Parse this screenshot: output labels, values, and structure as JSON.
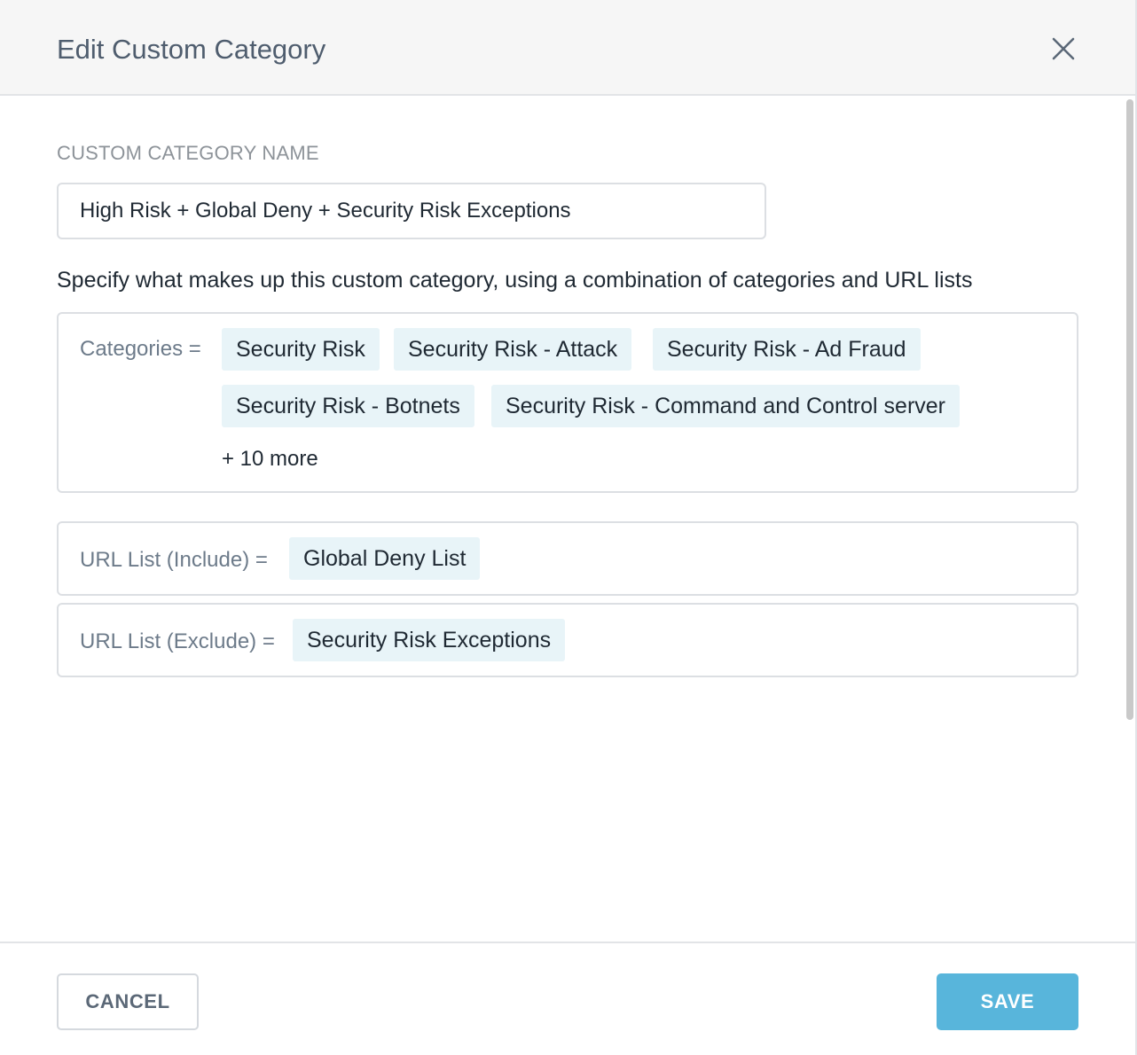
{
  "dialog": {
    "title": "Edit Custom Category",
    "close_icon": "close-icon"
  },
  "name_field": {
    "label": "CUSTOM CATEGORY NAME",
    "value": "High Risk + Global Deny + Security Risk Exceptions"
  },
  "description": "Specify what makes up this custom category, using a combination of categories and URL lists",
  "categories": {
    "label": "Categories =",
    "chips": [
      "Security Risk",
      "Security Risk - Attack",
      "Security Risk - Ad Fraud",
      "Security Risk - Botnets",
      "Security Risk - Command and Control server"
    ],
    "more": "+ 10 more"
  },
  "url_include": {
    "label": "URL List (Include) =",
    "chips": [
      "Global Deny List"
    ]
  },
  "url_exclude": {
    "label": "URL List (Exclude) =",
    "chips": [
      "Security Risk Exceptions"
    ]
  },
  "footer": {
    "cancel_label": "CANCEL",
    "save_label": "SAVE"
  },
  "colors": {
    "accent": "#58b5db",
    "chip_bg": "#e8f4f8",
    "header_bg": "#f6f6f6"
  }
}
